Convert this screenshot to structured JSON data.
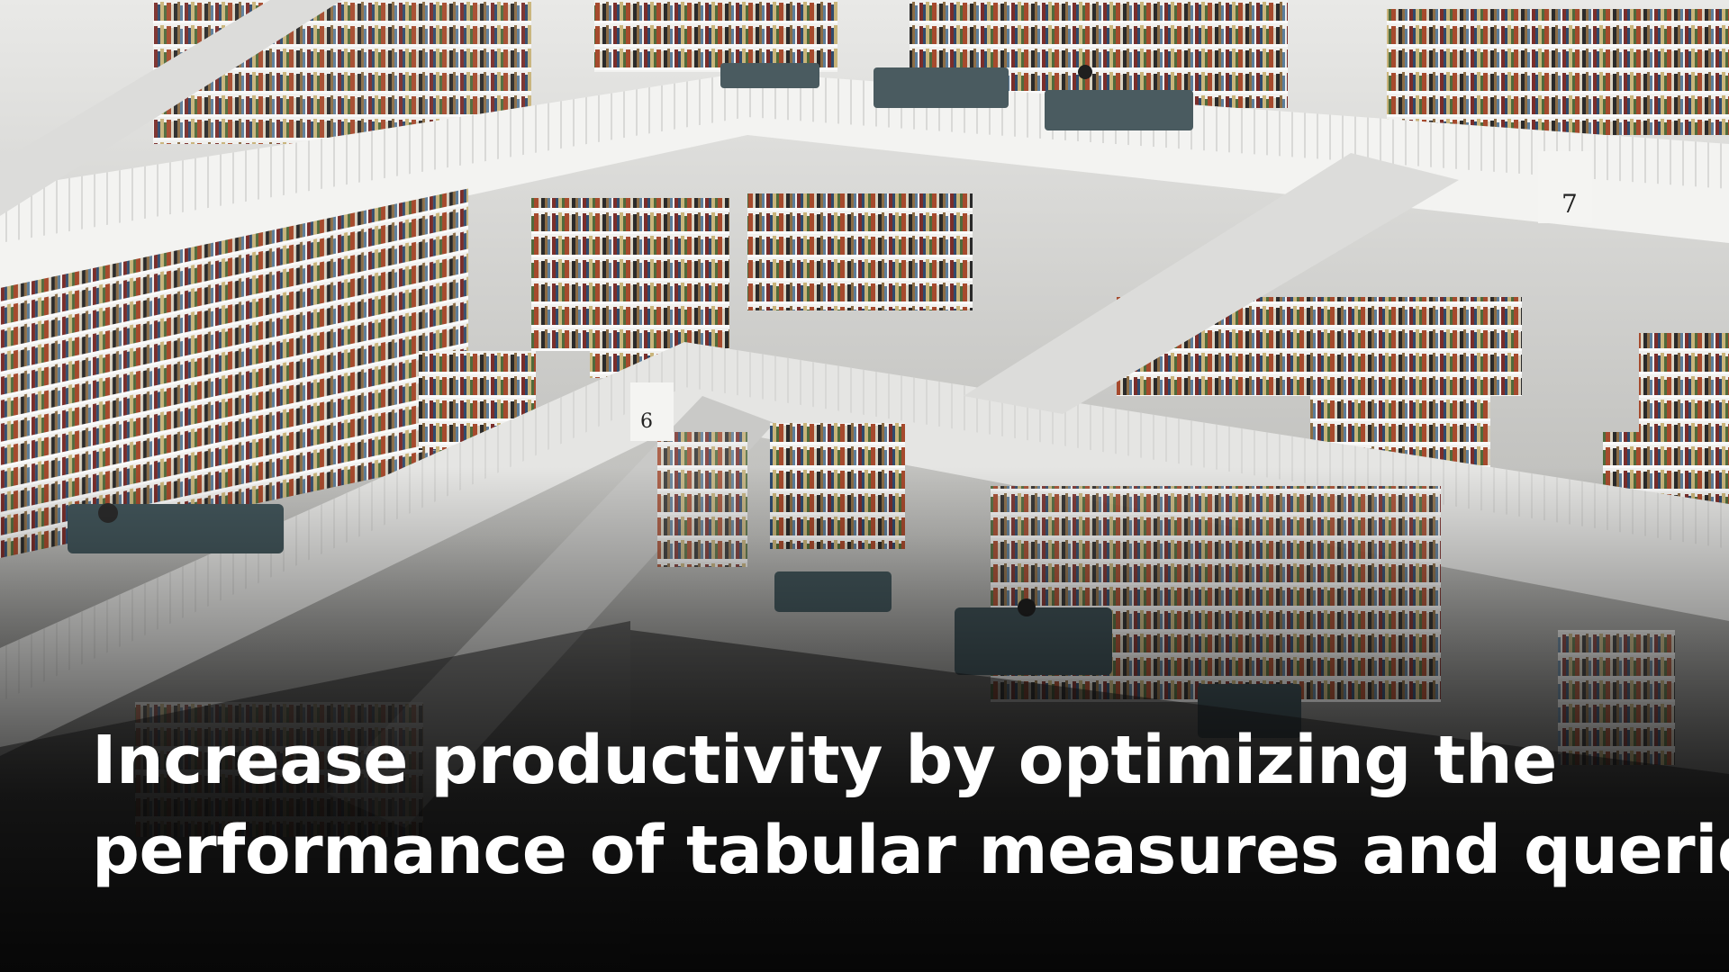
{
  "headline": {
    "line1": "Increase productivity by optimizing the",
    "line2": "performance of tabular measures and queries."
  },
  "photo": {
    "subject": "library-atrium",
    "colors": {
      "wall": "#e8e8e6",
      "floor": "#cfcfcc",
      "shadow": "#2b2b2b",
      "bench": "#4a5b60",
      "text": "#ffffff"
    }
  },
  "level_markers": [
    "7",
    "6"
  ]
}
